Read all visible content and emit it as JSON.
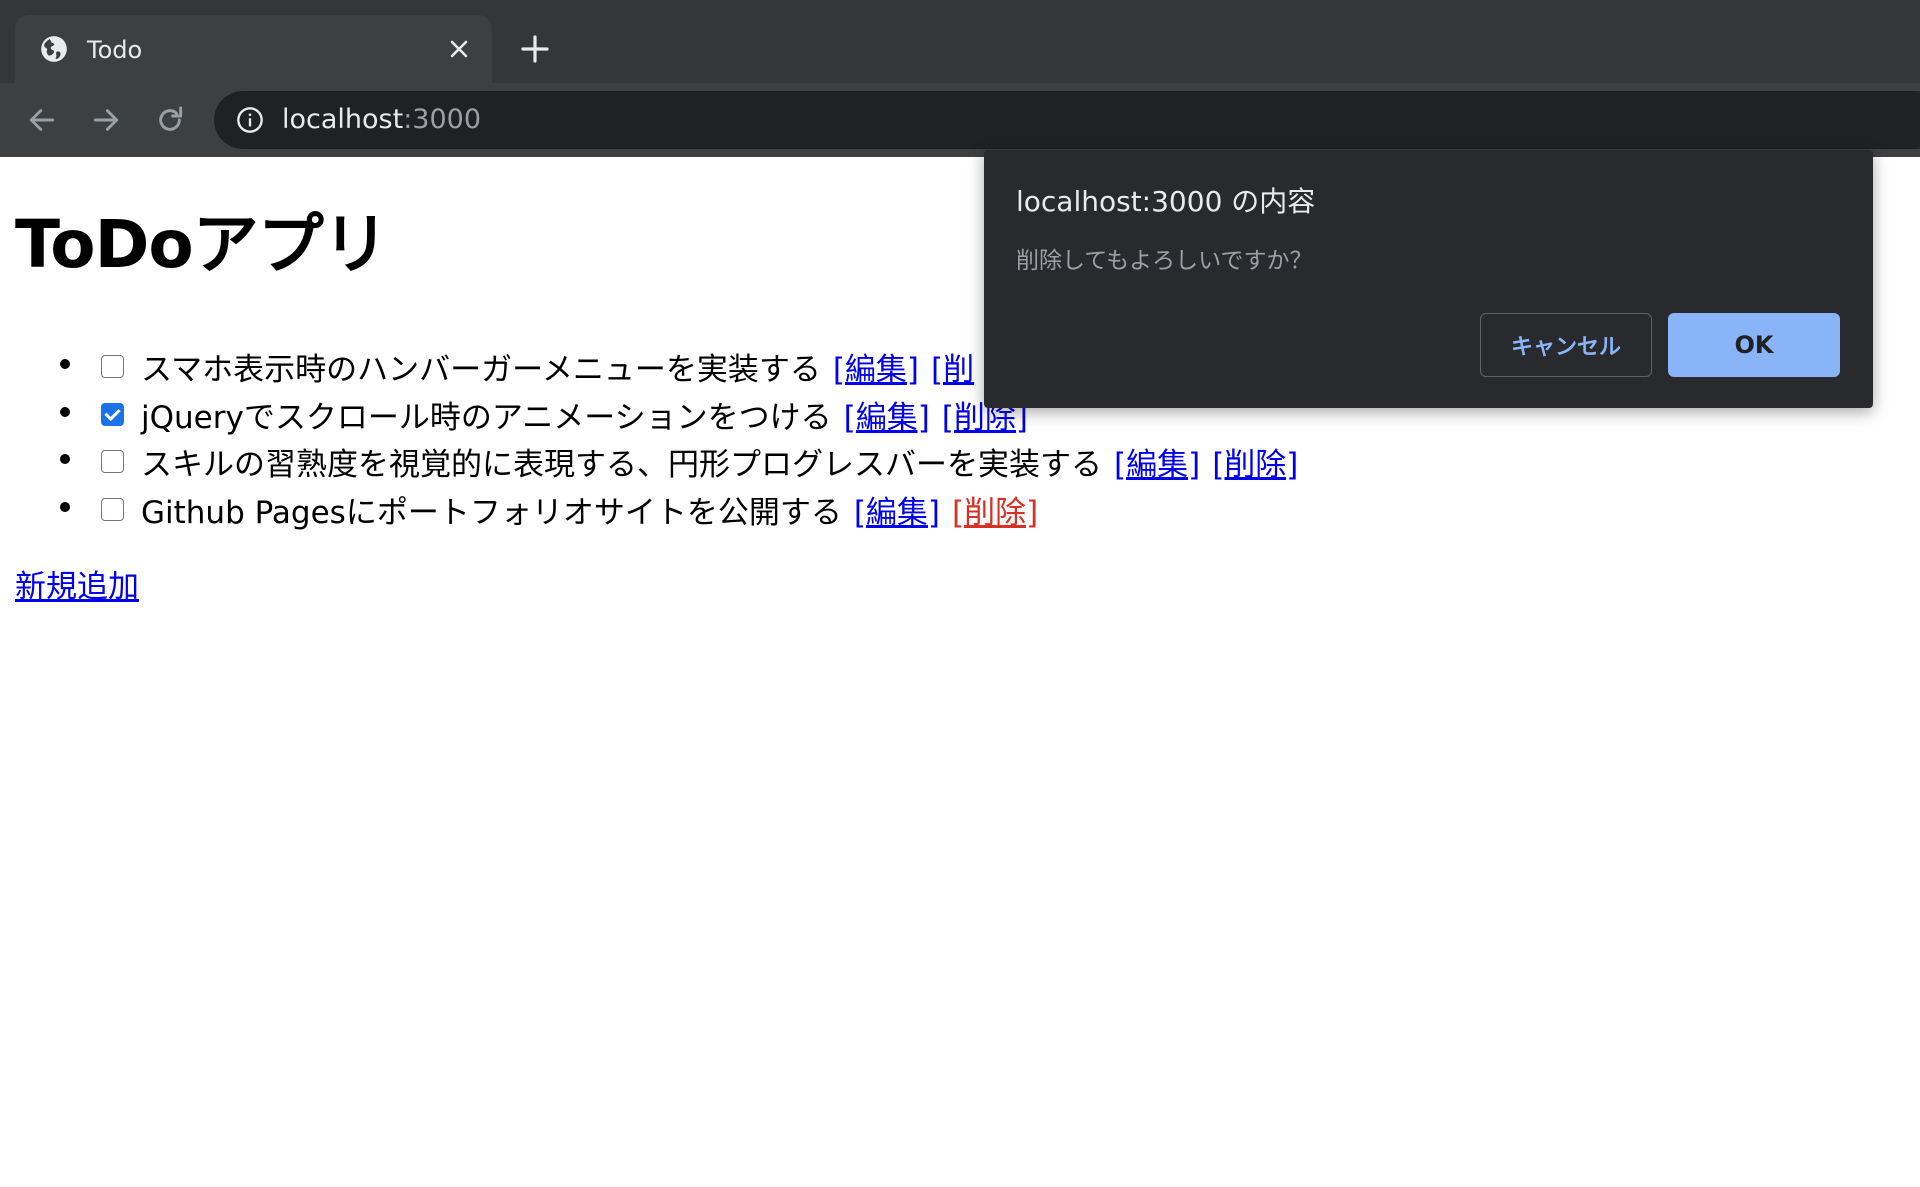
{
  "browser": {
    "tab_title": "Todo",
    "url_host": "localhost",
    "url_port": ":3000"
  },
  "page": {
    "title": "ToDoアプリ",
    "todos": [
      {
        "text": "スマホ表示時のハンバーガーメニューを実装する",
        "checked": false,
        "edit": "[編集]",
        "delete": "[削"
      },
      {
        "text": "jQueryでスクロール時のアニメーションをつける",
        "checked": true,
        "edit": "[編集]",
        "delete": "[削除]"
      },
      {
        "text": "スキルの習熟度を視覚的に表現する、円形プログレスバーを実装する",
        "checked": false,
        "edit": "[編集]",
        "delete": "[削除]"
      },
      {
        "text": "Github Pagesにポートフォリオサイトを公開する",
        "checked": false,
        "edit": "[編集]",
        "delete": "[削除]"
      }
    ],
    "add_link": "新規追加"
  },
  "dialog": {
    "title": "localhost:3000 の内容",
    "message": "削除してもよろしいですか？",
    "cancel_label": "キャンセル",
    "ok_label": "OK"
  }
}
